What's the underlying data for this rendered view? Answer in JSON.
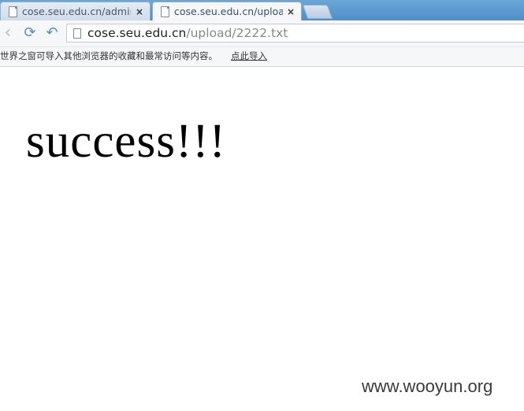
{
  "tabs": [
    {
      "title": "cose.seu.edu.cn/admin/",
      "close": "×",
      "active": false
    },
    {
      "title": "cose.seu.edu.cn/upload",
      "close": "×",
      "active": true
    }
  ],
  "toolbar": {
    "back_icon": "‹",
    "reload_icon": "⟳",
    "undo_icon": "↶"
  },
  "address": {
    "host": "cose.seu.edu.cn",
    "path": "/upload/2222.txt"
  },
  "bookmark_bar": {
    "message": "世界之窗可导入其他浏览器的收藏和最常访问等内容。",
    "import_link": "点此导入"
  },
  "page": {
    "body_text": "success!!!"
  },
  "watermark": "www.wooyun.org",
  "colors": {
    "tabbar": "#5e9ed6",
    "toolbar": "#f6f7f9",
    "nav_icon": "#5b8cc0"
  }
}
